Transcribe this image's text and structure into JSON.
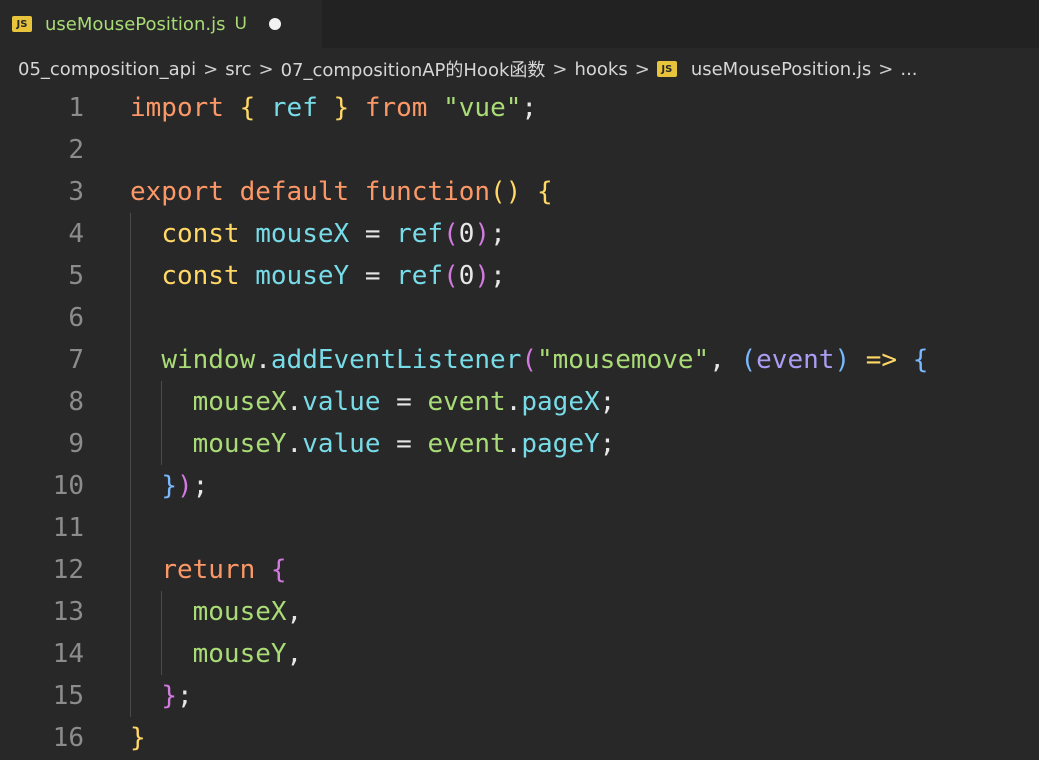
{
  "tab": {
    "icon": "js-file-icon",
    "badge": "JS",
    "title": "useMousePosition.js",
    "status": "U"
  },
  "breadcrumb": {
    "items": [
      "05_composition_api",
      "src",
      "07_compositionAP的Hook函数",
      "hooks"
    ],
    "file": "useMousePosition.js",
    "more": "...",
    "separator": ">"
  },
  "colors": {
    "background": "#282828",
    "keyword": "#fc9867",
    "variable": "#78dce8",
    "string": "#a9dc76",
    "text": "#e6e6e6",
    "bracket_yellow": "#ffd866",
    "bracket_purple": "#d27ae0",
    "bracket_blue": "#78b8ff",
    "param": "#ab9df2",
    "arrow": "#ffd866",
    "line_number": "#8c8c8c"
  },
  "code": [
    {
      "n": "1",
      "tokens": [
        [
          "import ",
          "keyword"
        ],
        [
          "{ ",
          "bracket_yellow"
        ],
        [
          "ref ",
          "variable"
        ],
        [
          "} ",
          "bracket_yellow"
        ],
        [
          "from ",
          "keyword"
        ],
        [
          "\"vue\"",
          "string"
        ],
        [
          ";",
          "text"
        ]
      ]
    },
    {
      "n": "2",
      "tokens": []
    },
    {
      "n": "3",
      "tokens": [
        [
          "export default function",
          "keyword"
        ],
        [
          "() {",
          "bracket_yellow"
        ]
      ]
    },
    {
      "n": "4",
      "tokens": [
        [
          "  ",
          "text"
        ],
        [
          "const ",
          "bracket_yellow"
        ],
        [
          "mouseX ",
          "variable"
        ],
        [
          "= ",
          "text"
        ],
        [
          "ref",
          "variable"
        ],
        [
          "(",
          "bracket_purple"
        ],
        [
          "0",
          "text"
        ],
        [
          ")",
          "bracket_purple"
        ],
        [
          ";",
          "text"
        ]
      ]
    },
    {
      "n": "5",
      "tokens": [
        [
          "  ",
          "text"
        ],
        [
          "const ",
          "bracket_yellow"
        ],
        [
          "mouseY ",
          "variable"
        ],
        [
          "= ",
          "text"
        ],
        [
          "ref",
          "variable"
        ],
        [
          "(",
          "bracket_purple"
        ],
        [
          "0",
          "text"
        ],
        [
          ")",
          "bracket_purple"
        ],
        [
          ";",
          "text"
        ]
      ]
    },
    {
      "n": "6",
      "tokens": []
    },
    {
      "n": "7",
      "tokens": [
        [
          "  ",
          "text"
        ],
        [
          "window",
          "string"
        ],
        [
          ".",
          "text"
        ],
        [
          "addEventListener",
          "variable"
        ],
        [
          "(",
          "bracket_purple"
        ],
        [
          "\"mousemove\"",
          "string"
        ],
        [
          ", ",
          "text"
        ],
        [
          "(",
          "bracket_blue"
        ],
        [
          "event",
          "param"
        ],
        [
          ") ",
          "bracket_blue"
        ],
        [
          "=> ",
          "arrow"
        ],
        [
          "{",
          "bracket_blue"
        ]
      ]
    },
    {
      "n": "8",
      "tokens": [
        [
          "    ",
          "text"
        ],
        [
          "mouseX",
          "string"
        ],
        [
          ".",
          "text"
        ],
        [
          "value ",
          "variable"
        ],
        [
          "= ",
          "text"
        ],
        [
          "event",
          "string"
        ],
        [
          ".",
          "text"
        ],
        [
          "pageX",
          "variable"
        ],
        [
          ";",
          "text"
        ]
      ]
    },
    {
      "n": "9",
      "tokens": [
        [
          "    ",
          "text"
        ],
        [
          "mouseY",
          "string"
        ],
        [
          ".",
          "text"
        ],
        [
          "value ",
          "variable"
        ],
        [
          "= ",
          "text"
        ],
        [
          "event",
          "string"
        ],
        [
          ".",
          "text"
        ],
        [
          "pageY",
          "variable"
        ],
        [
          ";",
          "text"
        ]
      ]
    },
    {
      "n": "10",
      "tokens": [
        [
          "  ",
          "text"
        ],
        [
          "}",
          "bracket_blue"
        ],
        [
          ")",
          "bracket_purple"
        ],
        [
          ";",
          "text"
        ]
      ]
    },
    {
      "n": "11",
      "tokens": []
    },
    {
      "n": "12",
      "tokens": [
        [
          "  ",
          "text"
        ],
        [
          "return ",
          "keyword"
        ],
        [
          "{",
          "bracket_purple"
        ]
      ]
    },
    {
      "n": "13",
      "tokens": [
        [
          "    ",
          "text"
        ],
        [
          "mouseX",
          "string"
        ],
        [
          ",",
          "text"
        ]
      ]
    },
    {
      "n": "14",
      "tokens": [
        [
          "    ",
          "text"
        ],
        [
          "mouseY",
          "string"
        ],
        [
          ",",
          "text"
        ]
      ]
    },
    {
      "n": "15",
      "tokens": [
        [
          "  ",
          "text"
        ],
        [
          "}",
          "bracket_purple"
        ],
        [
          ";",
          "text"
        ]
      ]
    },
    {
      "n": "16",
      "tokens": [
        [
          "}",
          "bracket_yellow"
        ]
      ]
    }
  ]
}
